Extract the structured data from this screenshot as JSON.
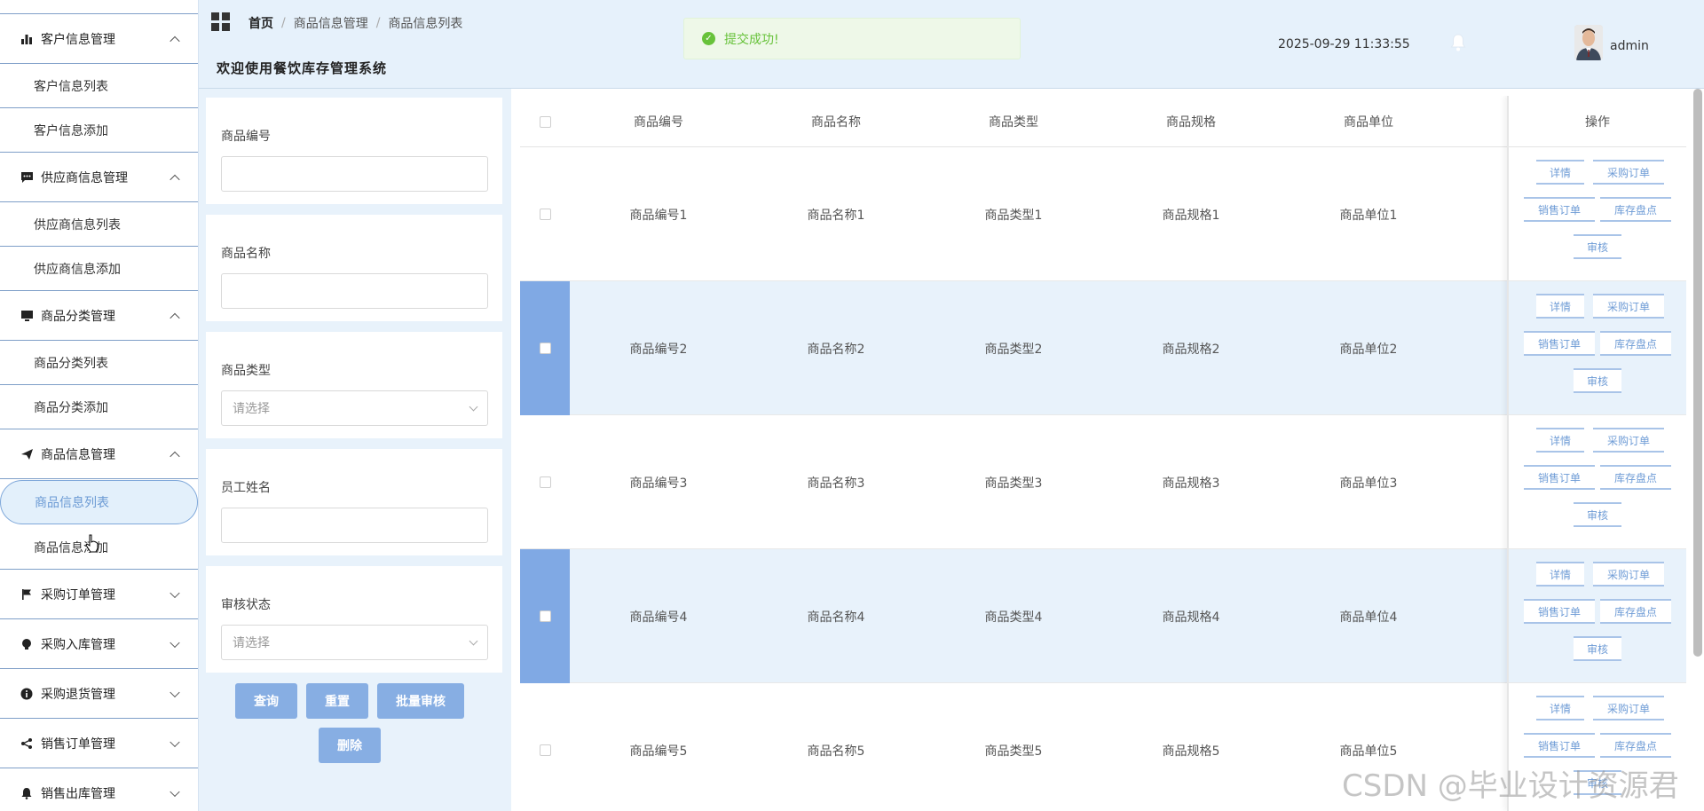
{
  "sidebar": {
    "groups": [
      {
        "label": "客户信息管理",
        "icon": "bar-chart-icon",
        "expanded": true,
        "items": [
          "客户信息列表",
          "客户信息添加"
        ]
      },
      {
        "label": "供应商信息管理",
        "icon": "chat-icon",
        "expanded": true,
        "items": [
          "供应商信息列表",
          "供应商信息添加"
        ]
      },
      {
        "label": "商品分类管理",
        "icon": "monitor-icon",
        "expanded": true,
        "items": [
          "商品分类列表",
          "商品分类添加"
        ]
      },
      {
        "label": "商品信息管理",
        "icon": "send-icon",
        "expanded": true,
        "items": [
          "商品信息列表",
          "商品信息添加"
        ]
      },
      {
        "label": "采购订单管理",
        "icon": "flag-icon",
        "expanded": false,
        "items": []
      },
      {
        "label": "采购入库管理",
        "icon": "bulb-icon",
        "expanded": false,
        "items": []
      },
      {
        "label": "采购退货管理",
        "icon": "info-icon",
        "expanded": false,
        "items": []
      },
      {
        "label": "销售订单管理",
        "icon": "share-icon",
        "expanded": false,
        "items": []
      },
      {
        "label": "销售出库管理",
        "icon": "bell-icon",
        "expanded": false,
        "items": []
      }
    ],
    "active_item": "商品信息列表"
  },
  "header": {
    "breadcrumb": [
      "首页",
      "商品信息管理",
      "商品信息列表"
    ],
    "welcome": "欢迎使用餐饮库存管理系统",
    "toast": "提交成功!",
    "datetime": "2025-09-29 11:33:55",
    "username": "admin"
  },
  "filters": {
    "fields": [
      {
        "label": "商品编号",
        "type": "input",
        "value": "",
        "placeholder": ""
      },
      {
        "label": "商品名称",
        "type": "input",
        "value": "",
        "placeholder": ""
      },
      {
        "label": "商品类型",
        "type": "select",
        "value": "",
        "placeholder": "请选择"
      },
      {
        "label": "员工姓名",
        "type": "input",
        "value": "",
        "placeholder": ""
      },
      {
        "label": "审核状态",
        "type": "select",
        "value": "",
        "placeholder": "请选择"
      }
    ],
    "buttons": {
      "query": "查询",
      "reset": "重置",
      "batch_audit": "批量审核",
      "delete": "删除"
    }
  },
  "table": {
    "columns": [
      "商品编号",
      "商品名称",
      "商品类型",
      "商品规格",
      "商品单位",
      "操作"
    ],
    "rows": [
      {
        "cells": [
          "商品编号1",
          "商品名称1",
          "商品类型1",
          "商品规格1",
          "商品单位1"
        ],
        "selected": false
      },
      {
        "cells": [
          "商品编号2",
          "商品名称2",
          "商品类型2",
          "商品规格2",
          "商品单位2"
        ],
        "selected": true
      },
      {
        "cells": [
          "商品编号3",
          "商品名称3",
          "商品类型3",
          "商品规格3",
          "商品单位3"
        ],
        "selected": false
      },
      {
        "cells": [
          "商品编号4",
          "商品名称4",
          "商品类型4",
          "商品规格4",
          "商品单位4"
        ],
        "selected": true
      },
      {
        "cells": [
          "商品编号5",
          "商品名称5",
          "商品类型5",
          "商品规格5",
          "商品单位5"
        ],
        "selected": false
      }
    ],
    "actions": [
      "详情",
      "采购订单",
      "销售订单",
      "库存盘点",
      "审核"
    ]
  },
  "watermark": "CSDN @毕业设计资源君",
  "colors": {
    "accent": "#80a9e4",
    "header_bg": "#e6f1fb",
    "success": "#67c23a",
    "button": "#87aee3"
  }
}
